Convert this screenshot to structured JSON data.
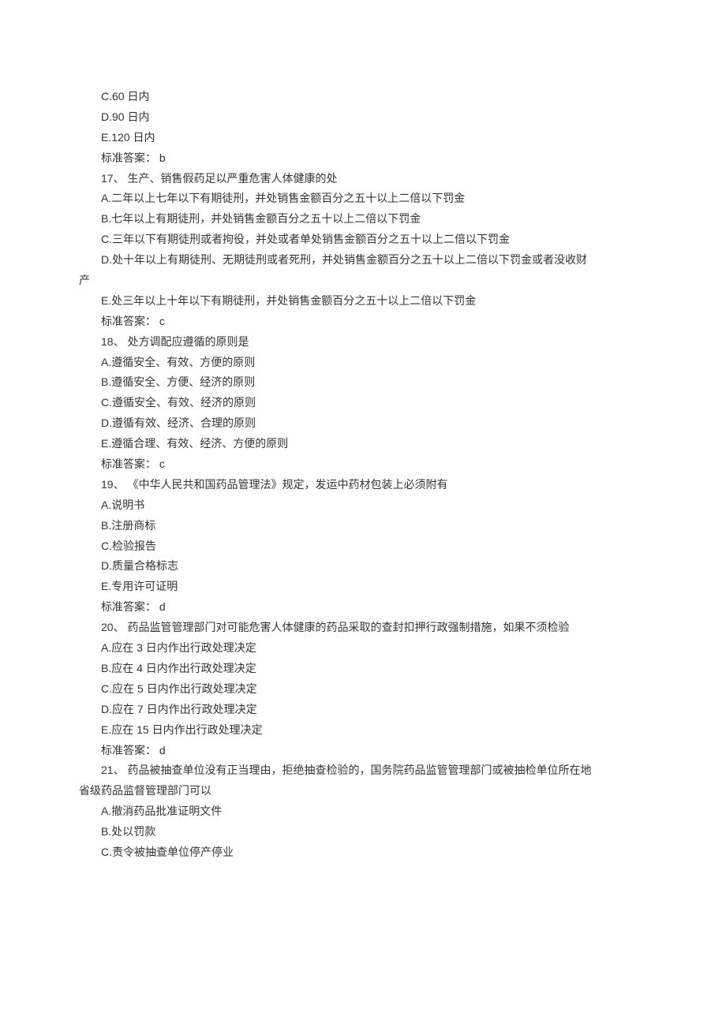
{
  "q16": {
    "optC": "C.60 日内",
    "optD": "D.90 日内",
    "optE": "E.120 日内",
    "answer": "标准答案： b"
  },
  "q17": {
    "stem": "17、 生产、销售假药足以严重危害人体健康的处",
    "optA": "A.二年以上七年以下有期徒刑，并处销售金额百分之五十以上二倍以下罚金",
    "optB": "B.七年以上有期徒刑，并处销售金额百分之五十以上二倍以下罚金",
    "optC": "C.三年以下有期徒刑或者拘役，并处或者单处销售金额百分之五十以上二倍以下罚金",
    "optD_part1": "D.处十年以上有期徒刑、无期徒刑或者死刑，并处销售金额百分之五十以上二倍以下罚金或者没收财",
    "optD_part2": "产",
    "optE": "E.处三年以上十年以下有期徒刑，并处销售金额百分之五十以上二倍以下罚金",
    "answer": "标准答案： c"
  },
  "q18": {
    "stem": "18、 处方调配应遵循的原则是",
    "optA": "A.遵循安全、有效、方便的原则",
    "optB": "B.遵循安全、方便、经济的原则",
    "optC": "C.遵循安全、有效、经济的原则",
    "optD": "D.遵循有效、经济、合理的原则",
    "optE": "E.遵循合理、有效、经济、方便的原则",
    "answer": "标准答案： c"
  },
  "q19": {
    "stem": "19、 《中华人民共和国药品管理法》规定，发运中药材包装上必须附有",
    "optA": "A.说明书",
    "optB": "B.注册商标",
    "optC": "C.检验报告",
    "optD": "D.质量合格标志",
    "optE": "E.专用许可证明",
    "answer": "标准答案： d"
  },
  "q20": {
    "stem": "20、 药品监管管理部门对可能危害人体健康的药品采取的查封扣押行政强制措施，如果不须检验",
    "optA": "A.应在 3 日内作出行政处理决定",
    "optB": "B.应在 4 日内作出行政处理决定",
    "optC": "C.应在 5 日内作出行政处理决定",
    "optD": "D.应在 7 日内作出行政处理决定",
    "optE": "E.应在 15 日内作出行政处理决定",
    "answer": "标准答案： d"
  },
  "q21": {
    "stem_part1": "21、 药品被抽查单位没有正当理由，拒绝抽查检验的，国务院药品监管管理部门或被抽检单位所在地",
    "stem_part2": "省级药品监督管理部门可以",
    "optA": "A.撤消药品批准证明文件",
    "optB": "B.处以罚款",
    "optC": "C.责令被抽查单位停产停业"
  }
}
